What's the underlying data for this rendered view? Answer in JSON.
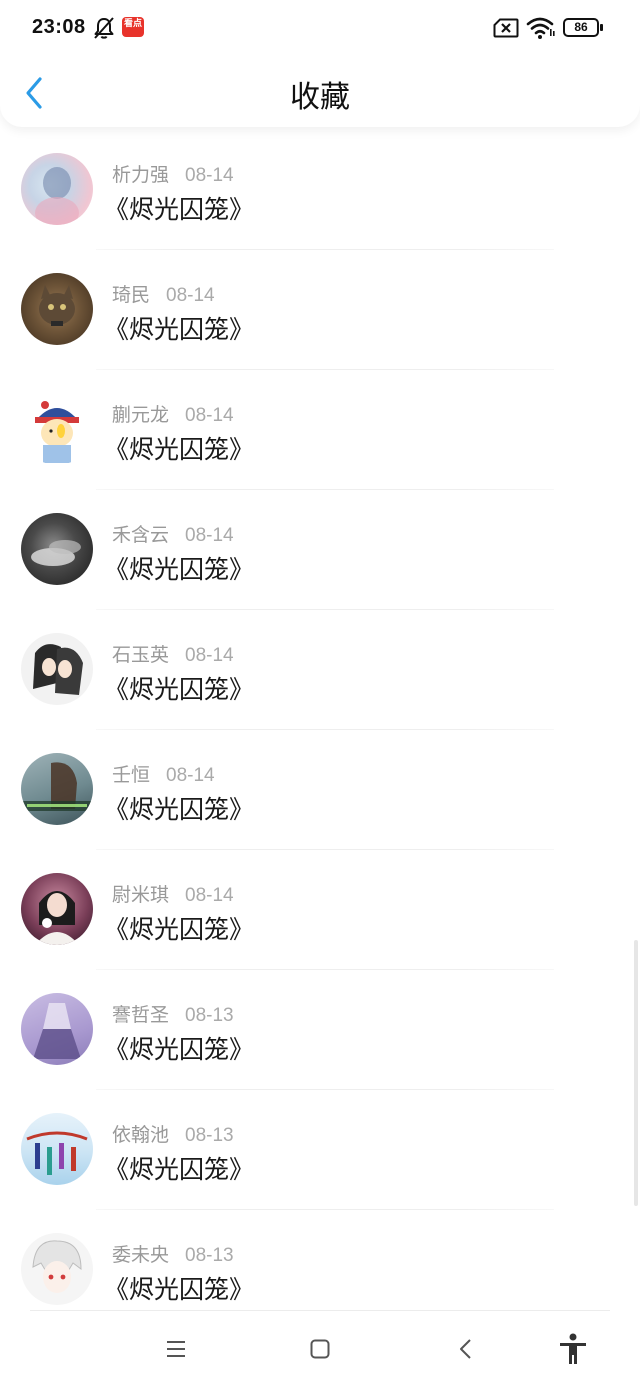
{
  "status_bar": {
    "time": "23:08",
    "app_badge": "看点",
    "battery": "86",
    "icons": [
      "bell-off-icon",
      "app-notification-icon",
      "sim-x-icon",
      "wifi-icon",
      "battery-icon"
    ]
  },
  "nav": {
    "title": "收藏",
    "back_icon": "chevron-left-icon",
    "accent": "#2b9be6"
  },
  "items": [
    {
      "name": "析力强",
      "date": "08-14",
      "book": "《烬光囚笼》"
    },
    {
      "name": "琦民",
      "date": "08-14",
      "book": "《烬光囚笼》"
    },
    {
      "name": "蒯元龙",
      "date": "08-14",
      "book": "《烬光囚笼》"
    },
    {
      "name": "禾含云",
      "date": "08-14",
      "book": "《烬光囚笼》"
    },
    {
      "name": "石玉英",
      "date": "08-14",
      "book": "《烬光囚笼》"
    },
    {
      "name": "壬恒",
      "date": "08-14",
      "book": "《烬光囚笼》"
    },
    {
      "name": "尉米琪",
      "date": "08-14",
      "book": "《烬光囚笼》"
    },
    {
      "name": "謇哲圣",
      "date": "08-13",
      "book": "《烬光囚笼》"
    },
    {
      "name": "依翰池",
      "date": "08-13",
      "book": "《烬光囚笼》"
    },
    {
      "name": "委未央",
      "date": "08-13",
      "book": "《烬光囚笼》"
    }
  ],
  "system_nav": {
    "icons": [
      "menu-icon",
      "home-square-icon",
      "back-chevron-icon",
      "accessibility-icon"
    ]
  }
}
